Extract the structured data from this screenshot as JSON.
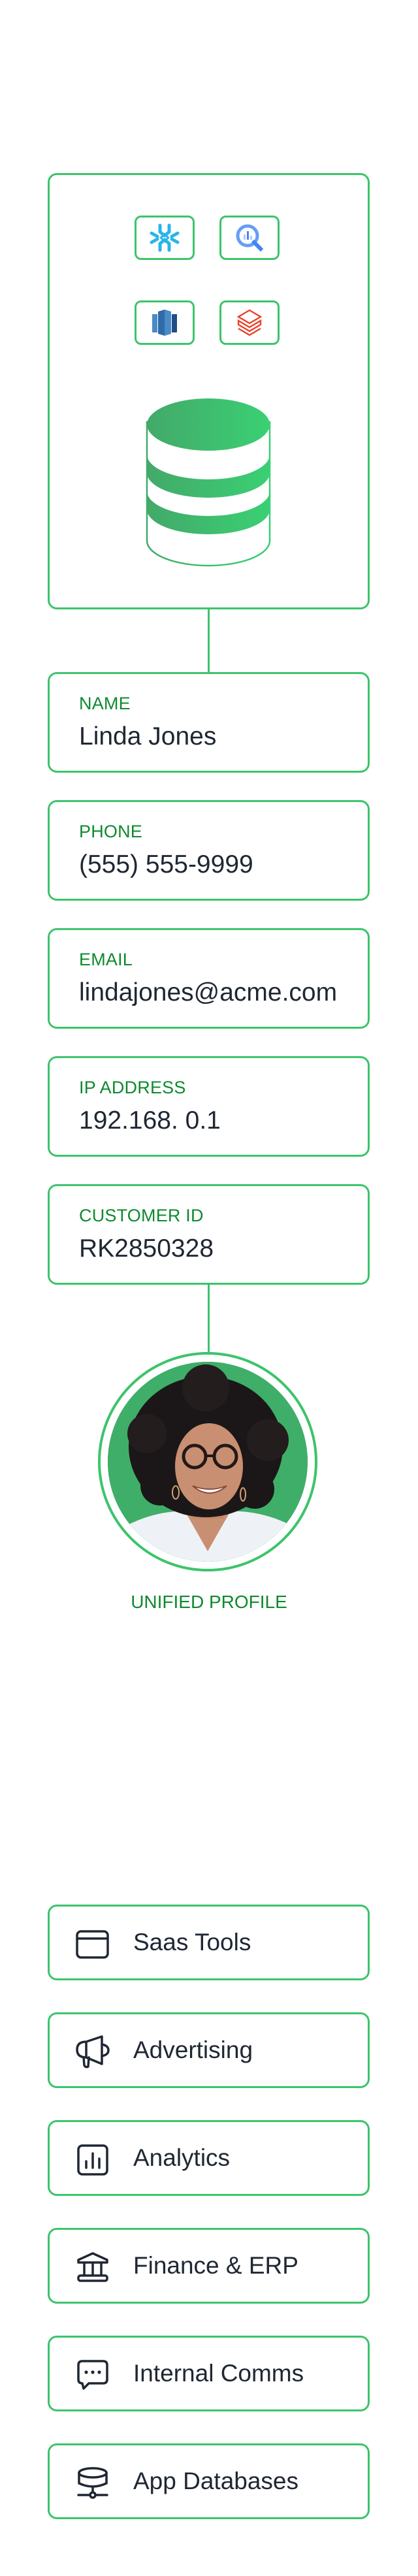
{
  "colors": {
    "accent_green": "#3cc46b",
    "label_green": "#0e8a2e",
    "text_dark": "#1f2733",
    "db_green": "#3fb56a"
  },
  "sources": {
    "logos": [
      {
        "name": "snowflake",
        "icon": "snowflake-icon"
      },
      {
        "name": "bigquery",
        "icon": "bigquery-icon"
      },
      {
        "name": "redshift",
        "icon": "redshift-icon"
      },
      {
        "name": "databricks",
        "icon": "databricks-icon"
      }
    ],
    "center_icon": "database-icon"
  },
  "fields": [
    {
      "label": "NAME",
      "value": "Linda Jones"
    },
    {
      "label": "PHONE",
      "value": "(555) 555-9999"
    },
    {
      "label": "EMAIL",
      "value": "lindajones@acme.com"
    },
    {
      "label": "IP ADDRESS",
      "value": "192.168. 0.1"
    },
    {
      "label": "CUSTOMER ID",
      "value": "RK2850328"
    }
  ],
  "profile": {
    "label": "UNIFIED PROFILE",
    "photo": "smiling woman with curly hair and glasses"
  },
  "categories": [
    {
      "label": "Saas Tools",
      "icon": "browser-window-icon"
    },
    {
      "label": "Advertising",
      "icon": "megaphone-icon"
    },
    {
      "label": "Analytics",
      "icon": "bar-chart-icon"
    },
    {
      "label": "Finance & ERP",
      "icon": "bank-icon"
    },
    {
      "label": "Internal Comms",
      "icon": "chat-bubble-icon"
    },
    {
      "label": "App Databases",
      "icon": "network-database-icon"
    }
  ]
}
